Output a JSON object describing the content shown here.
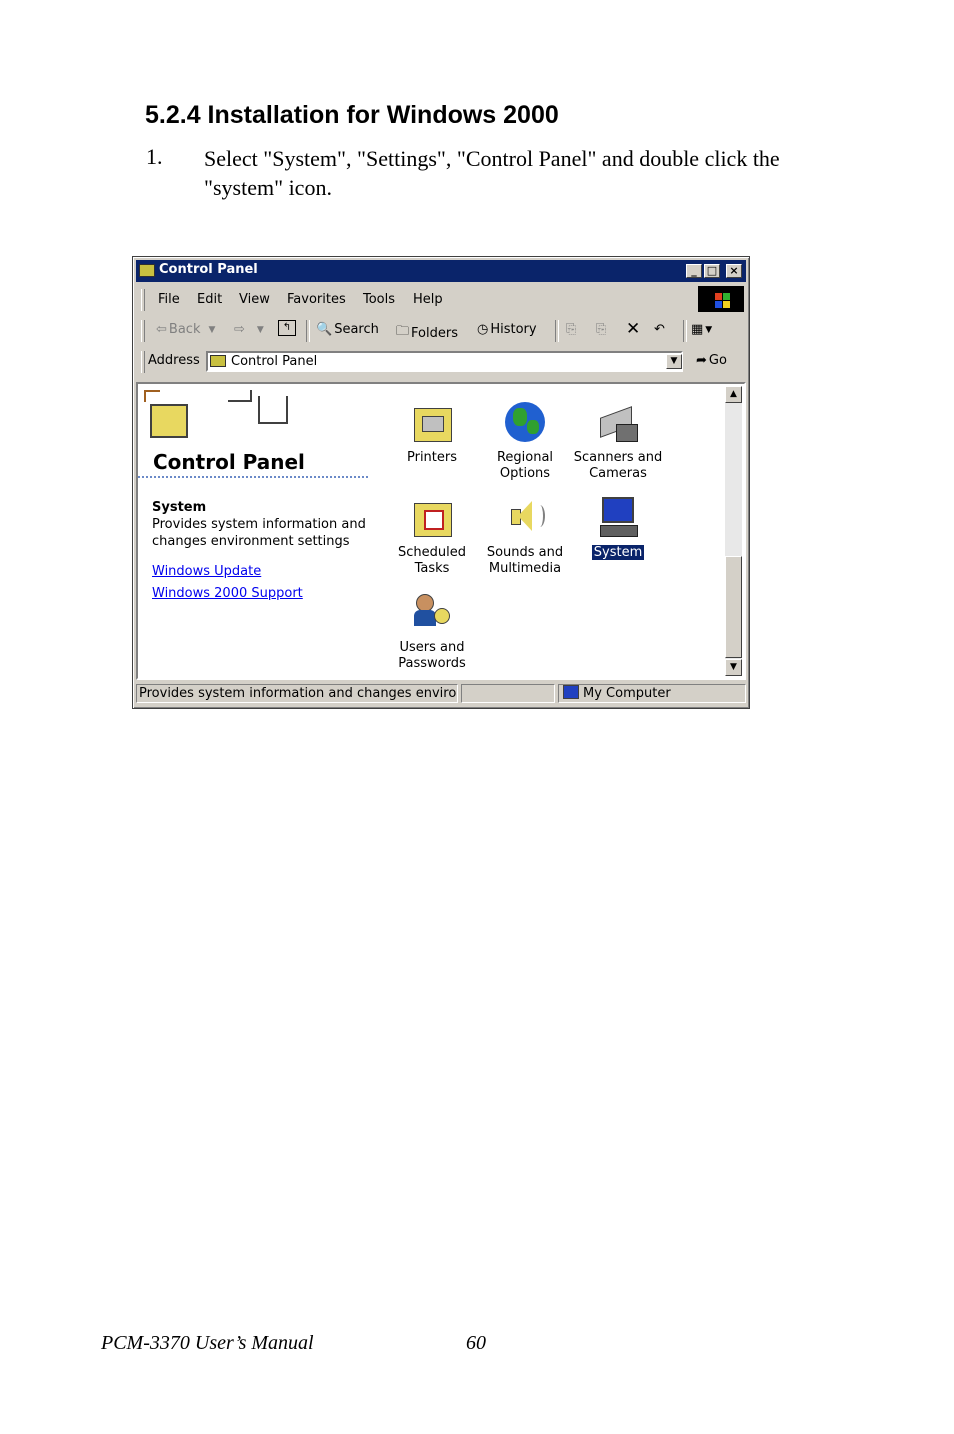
{
  "heading": "5.2.4 Installation for Windows 2000",
  "step": {
    "number": "1.",
    "line1": "Select \"System\", \"Settings\", \"Control Panel\" and double click the",
    "line2": "\"system\" icon."
  },
  "window": {
    "title": "Control Panel",
    "controls": {
      "minimize": "_",
      "maximize": "□",
      "close": "×"
    },
    "menu": [
      "File",
      "Edit",
      "View",
      "Favorites",
      "Tools",
      "Help"
    ],
    "toolbar": {
      "back": "Back",
      "search": "Search",
      "folders": "Folders",
      "history": "History"
    },
    "address": {
      "label": "Address",
      "value": "Control Panel",
      "go": "Go"
    },
    "sidebar": {
      "title": "Control Panel",
      "selected_name": "System",
      "selected_description": "Provides system information and changes environment settings",
      "links": [
        "Windows Update",
        "Windows 2000 Support"
      ]
    },
    "icons": [
      {
        "label": "Printers",
        "icon": "printer-folder-icon"
      },
      {
        "label": "Regional Options",
        "icon": "globe-icon"
      },
      {
        "label": "Scanners and Cameras",
        "icon": "scanner-camera-icon"
      },
      {
        "label": "Scheduled Tasks",
        "icon": "scheduled-tasks-folder-icon"
      },
      {
        "label": "Sounds and Multimedia",
        "icon": "speaker-icon"
      },
      {
        "label": "System",
        "icon": "computer-icon",
        "selected": true
      },
      {
        "label": "Users and Passwords",
        "icon": "users-keys-icon"
      }
    ],
    "status": {
      "text": "Provides system information and changes environmen",
      "zone": "My Computer"
    },
    "colors": {
      "titlebar": "#0a246a",
      "face": "#d4d0c8",
      "selection": "#0a246a",
      "link": "#0000ee"
    }
  },
  "footer": {
    "title": "PCM-3370 User’s Manual",
    "page": "60"
  }
}
